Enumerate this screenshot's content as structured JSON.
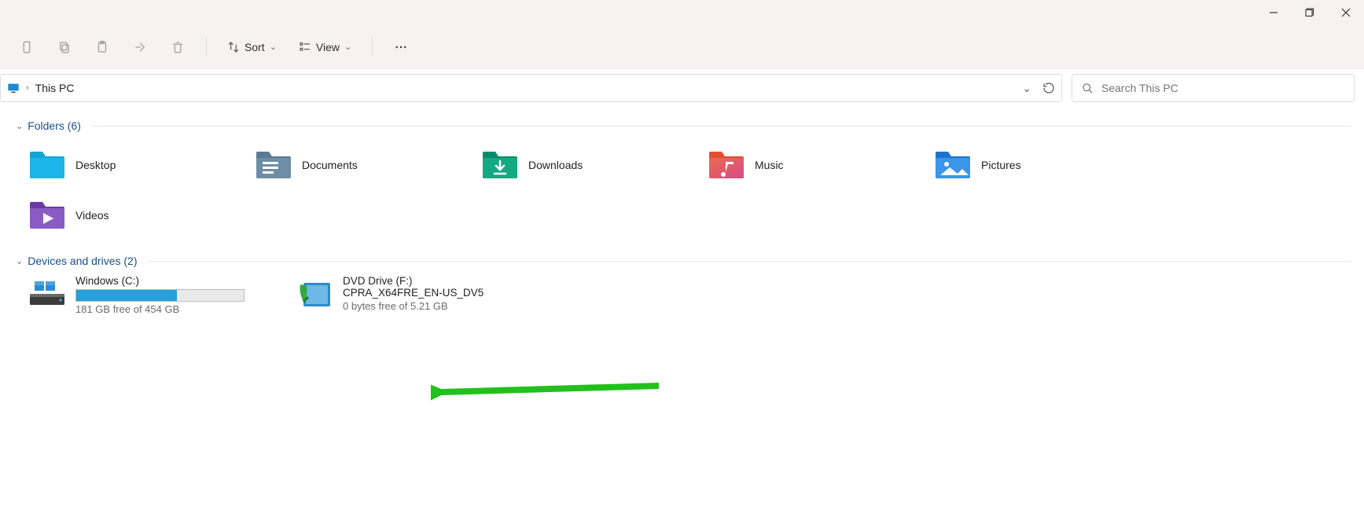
{
  "window": {
    "title": "This PC"
  },
  "toolbar": {
    "sort_label": "Sort",
    "view_label": "View"
  },
  "address": {
    "location": "This PC"
  },
  "search": {
    "placeholder": "Search This PC"
  },
  "groups": {
    "folders": {
      "header": "Folders (6)",
      "items": [
        "Desktop",
        "Documents",
        "Downloads",
        "Music",
        "Pictures",
        "Videos"
      ]
    },
    "drives": {
      "header": "Devices and drives (2)",
      "items": [
        {
          "name": "Windows (C:)",
          "free_label": "181 GB free of 454 GB",
          "fill_pct": 60
        },
        {
          "name_line1": "DVD Drive (F:)",
          "name_line2": "CPRA_X64FRE_EN-US_DV5",
          "free_label": "0 bytes free of 5.21 GB"
        }
      ]
    }
  }
}
